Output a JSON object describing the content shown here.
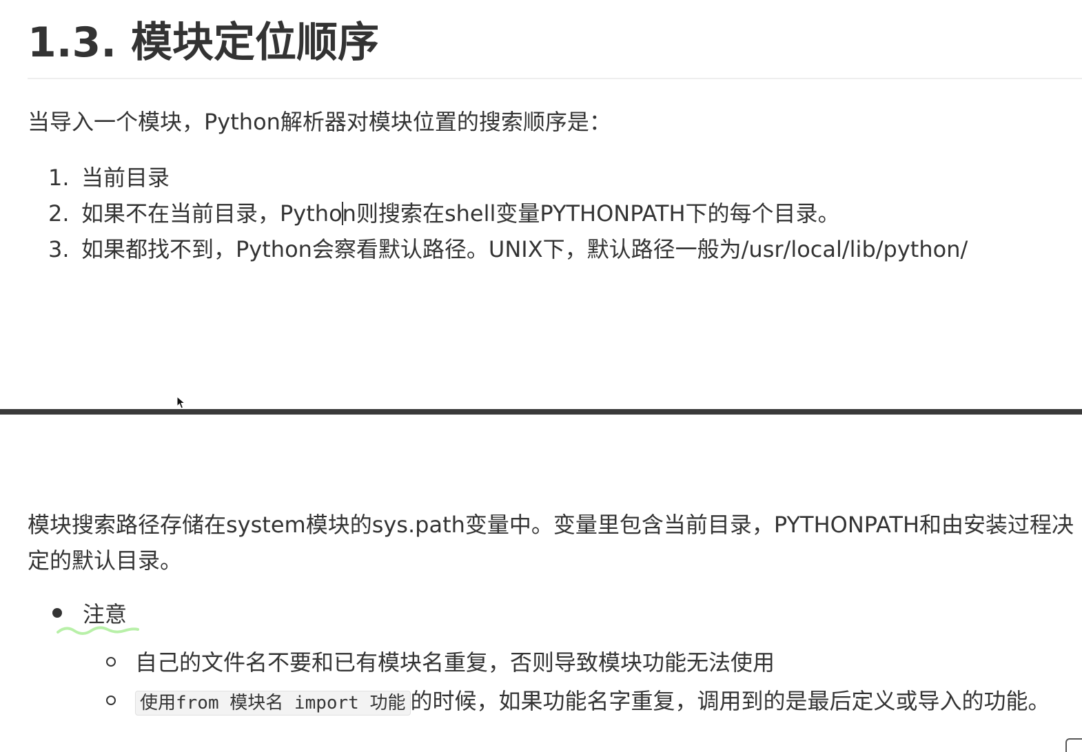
{
  "document": {
    "title": "1.3. 模块定位顺序",
    "intro": "当导入一个模块，Python解析器对模块位置的搜索顺序是：",
    "search_order": [
      {
        "num": "1.",
        "text": "当前目录"
      },
      {
        "num": "2.",
        "text_before_cursor": "如果不在当前目录，Pytho",
        "text_after_cursor": "n则搜索在shell变量PYTHONPATH下的每个目录。"
      },
      {
        "num": "3.",
        "text": "如果都找不到，Python会察看默认路径。UNIX下，默认路径一般为/usr/local/lib/python/"
      }
    ],
    "paragraph": "模块搜索路径存储在system模块的sys.path变量中。变量里包含当前目录，PYTHONPATH和由安装过程决定的默认目录。",
    "note": {
      "label": "注意",
      "items": [
        {
          "text": "自己的文件名不要和已有模块名重复，否则导致模块功能无法使用"
        },
        {
          "code": "使用from 模块名 import 功能",
          "text": "的时候，如果功能名字重复，调用到的是最后定义或导入的功能。"
        }
      ]
    }
  },
  "colors": {
    "text": "#333333",
    "divider": "#3a3a3a",
    "annotation": "#b8f0a8"
  }
}
